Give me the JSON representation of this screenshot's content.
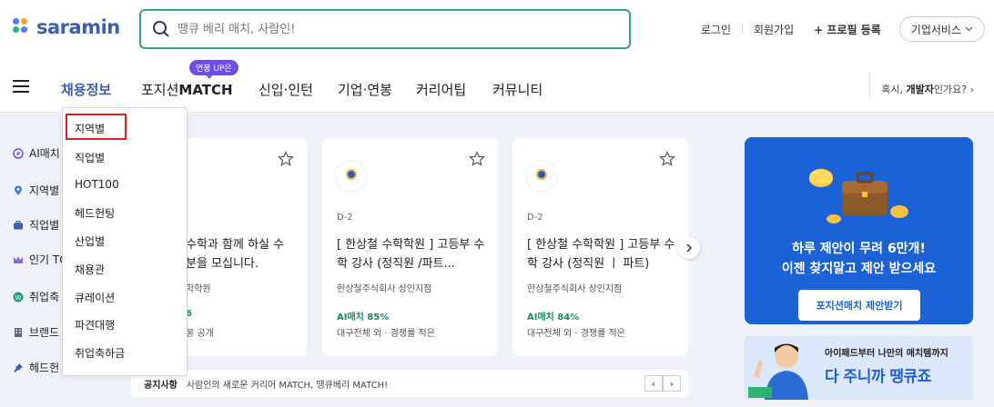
{
  "header": {
    "logo_text": "saramin",
    "search_placeholder": "땡큐 베리 매치, 사람인!",
    "links": {
      "login": "로그인",
      "signup": "회원가입",
      "profile": "+ 프로필 등록",
      "corporate": "기업서비스"
    }
  },
  "nav": {
    "items": [
      "채용정보",
      "포지션MATCH",
      "신입·인턴",
      "기업·연봉",
      "커리어팁",
      "커뮤니티"
    ],
    "badge": "연봉 UP은",
    "developer_link_pre": "혹시, ",
    "developer_link_bold": "개발자",
    "developer_link_post": "인가요?"
  },
  "dropdown": {
    "items": [
      "지역별",
      "직업별",
      "HOT100",
      "헤드헌팅",
      "산업별",
      "채용관",
      "큐레이션",
      "파견대행",
      "취업축하금"
    ]
  },
  "sidebar": {
    "items": [
      "AI매치",
      "지역별",
      "직업별",
      "인기 TOP",
      "취업축",
      "브랜드",
      "헤드헌"
    ]
  },
  "cards": [
    {
      "dday": "",
      "title": "수학과 함께 하실 수 분을 모십니다.",
      "company": "학학원",
      "ai": "6",
      "meta": "봉 공개"
    },
    {
      "dday": "D-2",
      "title": "[ 한상철 수학학원 ] 고등부 수학 강사 (정직원 /파트...",
      "company": "한상철주식회사 상인지점",
      "ai": "AI매치 85%",
      "meta": "대구전체 외 · 경쟁률 적은"
    },
    {
      "dday": "D-2",
      "title": "[ 한상철 수학학원 ] 고등부 수학 강사 (정직원 ㅣ 파트)",
      "company": "한상철주식회사 상인지점",
      "ai": "AI매치 84%",
      "meta": "대구전체 외 · 경쟁률 적은"
    }
  ],
  "notice": {
    "label": "공지사항",
    "text": "사람인의 새로운 커리어 MATCH, 땡큐베리 MATCH!"
  },
  "promo": {
    "line1": "하루 제안이 무려 6만개!",
    "line2": "이젠 찾지말고 제안 받으세요",
    "cta": "포지션매치 제안받기"
  },
  "banner2": {
    "top": "아이패드부터 나만의 매치템까지",
    "main": "다 주니까 땡큐죠"
  },
  "colors": {
    "brand_blue": "#3d5eb2",
    "search_border": "#2ea58c",
    "promo_blue": "#1a62d6",
    "highlight_red": "#e02020",
    "badge_purple": "#6b4ee6"
  }
}
